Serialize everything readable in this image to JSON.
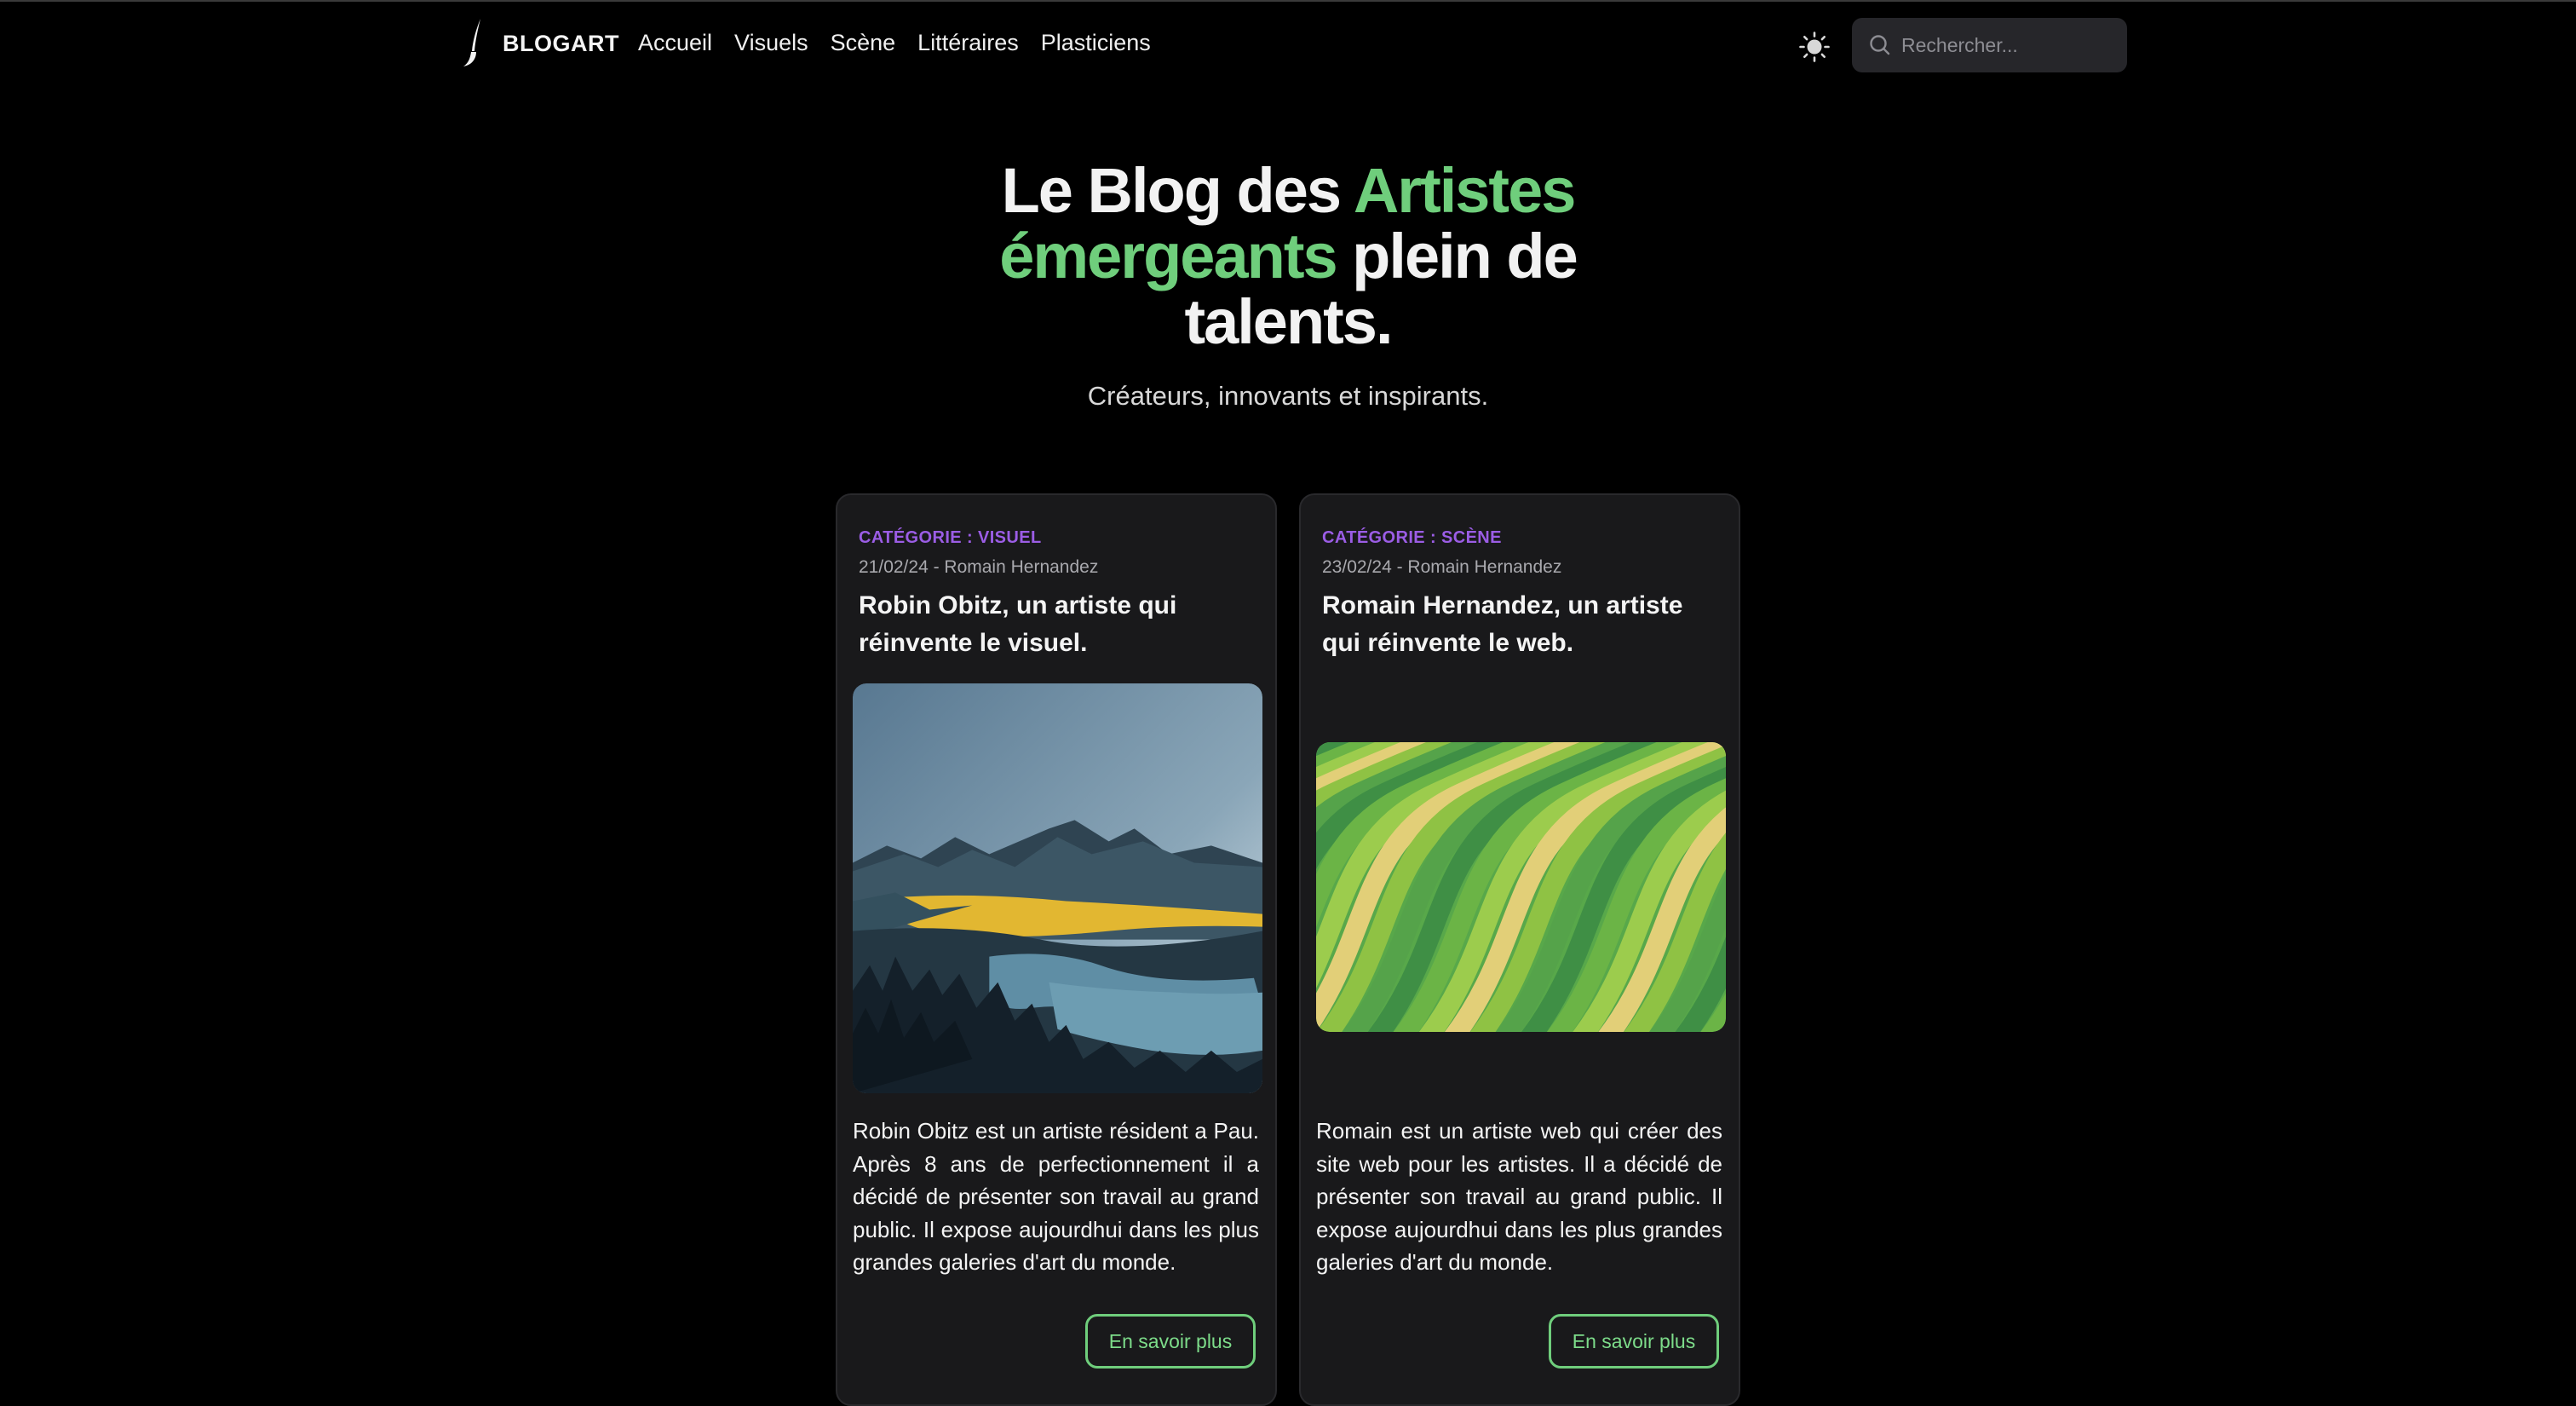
{
  "navbar": {
    "brand": "BLOGART",
    "links": [
      {
        "label": "Accueil"
      },
      {
        "label": "Visuels"
      },
      {
        "label": "Scène"
      },
      {
        "label": "Littéraires"
      },
      {
        "label": "Plasticiens"
      }
    ],
    "theme_toggle_icon": "sun-icon",
    "search": {
      "placeholder": "Rechercher...",
      "icon": "search-icon"
    }
  },
  "hero": {
    "title_part1": "Le Blog des ",
    "title_accent": "Artistes émergeants",
    "title_part2": "  plein de talents.",
    "subtitle": "Créateurs, innovants et inspirants."
  },
  "articles": [
    {
      "category": "CATÉGORIE : VISUEL",
      "meta": "21/02/24 - Romain Hernandez",
      "title": "Robin Obitz, un artiste qui réinvente le visuel.",
      "image_alt": "mountain-lake-landscape",
      "text": "Robin Obitz est un artiste résident a Pau. Après 8 ans de perfectionnement il a décidé de présenter son travail au grand public. Il expose aujourdhui dans les plus grandes galeries d'art du monde.",
      "button": "En savoir plus"
    },
    {
      "category": "CATÉGORIE : SCÈNE",
      "meta": "23/02/24 - Romain Hernandez",
      "title": "Romain Hernandez, un artiste qui réinvente le web.",
      "image_alt": "green-wave-pattern",
      "text": "Romain est un artiste web qui créer des site web pour les artistes. Il a décidé de présenter son travail au grand public. Il expose aujourdhui dans les plus grandes galeries d'art du monde.",
      "button": "En savoir plus"
    }
  ],
  "colors": {
    "background": "#000000",
    "accent_green": "#6fce7c",
    "category_purple": "#9b5de5",
    "card_background": "#19191b"
  }
}
